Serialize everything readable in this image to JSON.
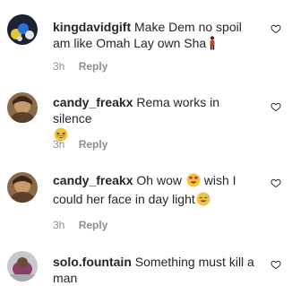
{
  "comments": [
    {
      "username": "kingdavidgift",
      "text": "Make Dem no spoil am like Omah Lay own Sha",
      "emoji": "person-standing-emoji",
      "time": "3h",
      "reply_label": "Reply",
      "avatar": "avatar-kingdavidgift"
    },
    {
      "username": "candy_freakx",
      "text": "Rema works in silence",
      "emoji": "grinning-squinting-emoji",
      "time": "3h",
      "reply_label": "Reply",
      "avatar": "avatar-candy-freakx"
    },
    {
      "username": "candy_freakx",
      "text_part1": "Oh wow",
      "emoji_1": "heart-eyes-emoji",
      "text_part2": "wish I could her face in day light",
      "emoji_2": "smiling-sweat-emoji",
      "time": "3h",
      "reply_label": "Reply",
      "avatar": "avatar-candy-freakx"
    },
    {
      "username": "solo.fountain",
      "text": "Something must kill a man",
      "avatar": "avatar-solo-fountain"
    }
  ],
  "icons": {
    "like": "heart-outline-icon"
  },
  "colors": {
    "text": "#262626",
    "secondary": "#8e8e8e",
    "emoji_yellow": "#f5c33b"
  }
}
